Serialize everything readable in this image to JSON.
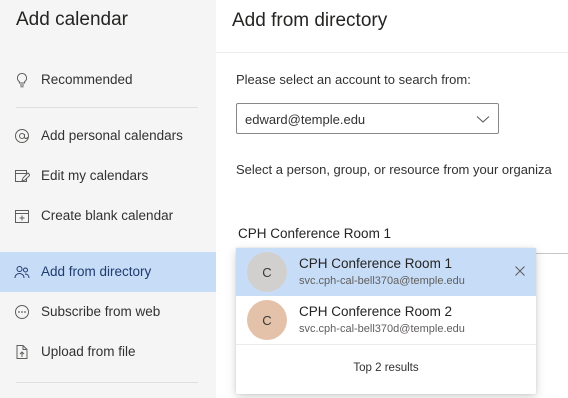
{
  "sidebar": {
    "title": "Add calendar",
    "items": [
      {
        "label": "Recommended",
        "icon": "lightbulb-icon"
      },
      {
        "label": "Add personal calendars",
        "icon": "at-sign-icon"
      },
      {
        "label": "Edit my calendars",
        "icon": "edit-calendar-icon"
      },
      {
        "label": "Create blank calendar",
        "icon": "calendar-add-icon"
      },
      {
        "label": "Add from directory",
        "icon": "people-icon",
        "active": true
      },
      {
        "label": "Subscribe from web",
        "icon": "globe-link-icon"
      },
      {
        "label": "Upload from file",
        "icon": "document-upload-icon"
      }
    ]
  },
  "main": {
    "title": "Add from directory",
    "account_prompt": "Please select an account to search from:",
    "account_value": "edward@temple.edu",
    "instruction": "Select a person, group, or resource from your organiza",
    "search_value": "CPH Conference Room 1",
    "results": [
      {
        "initial": "C",
        "name": "CPH Conference Room 1",
        "email": "svc.cph-cal-bell370a@temple.edu"
      },
      {
        "initial": "C",
        "name": "CPH Conference Room 2",
        "email": "svc.cph-cal-bell370d@temple.edu"
      }
    ],
    "results_footer": "Top 2 results"
  },
  "colors": {
    "active_bg": "#c7dcf7",
    "sidebar_bg": "#f5f5f5",
    "avatar_gray": "#d2d0ce",
    "avatar_tan": "#e3c2a9"
  }
}
